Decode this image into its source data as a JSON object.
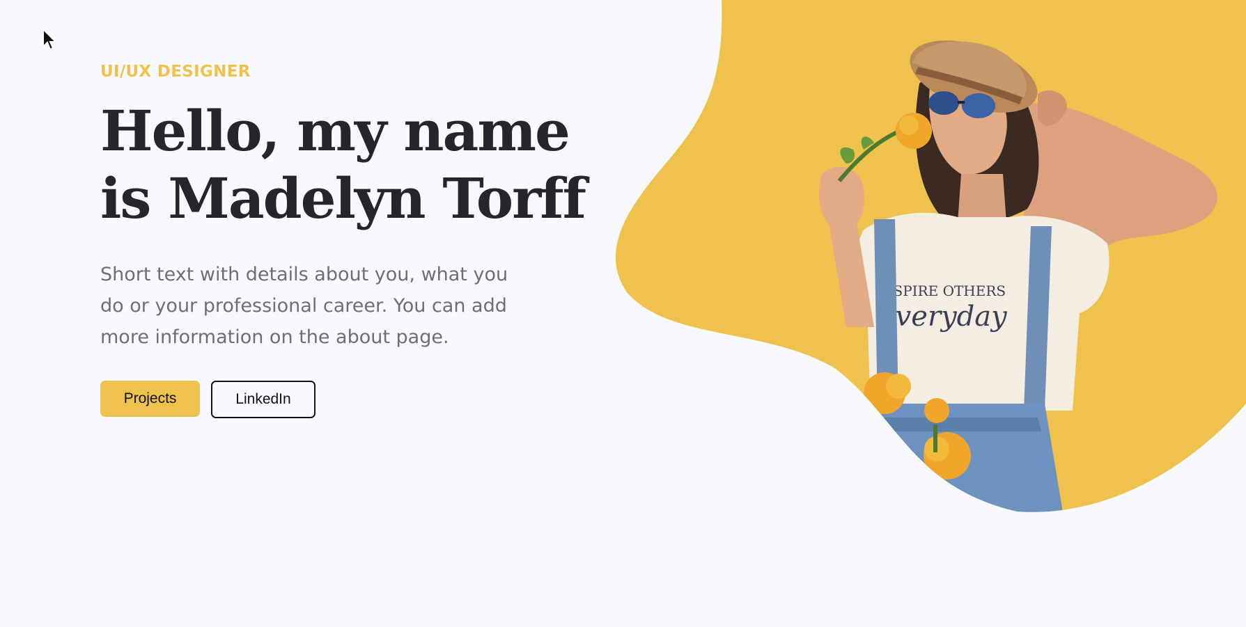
{
  "hero": {
    "eyebrow": "UI/UX DESIGNER",
    "headline_line1": "Hello,  my name",
    "headline_line2": "is Madelyn Torff",
    "intro": "Short text with details about you, what you do or your professional career. You can add more information on the about page.",
    "buttons": {
      "projects": "Projects",
      "linkedin": "LinkedIn"
    }
  },
  "portrait_shirt_text": {
    "line1": "NSPIRE OTHERS",
    "line2": "everyday"
  },
  "colors": {
    "accent": "#eec24c",
    "heading": "#24262b",
    "body_text": "#6d6f74",
    "background": "#f8f9fd"
  },
  "icons": {
    "cursor": "cursor-icon"
  }
}
